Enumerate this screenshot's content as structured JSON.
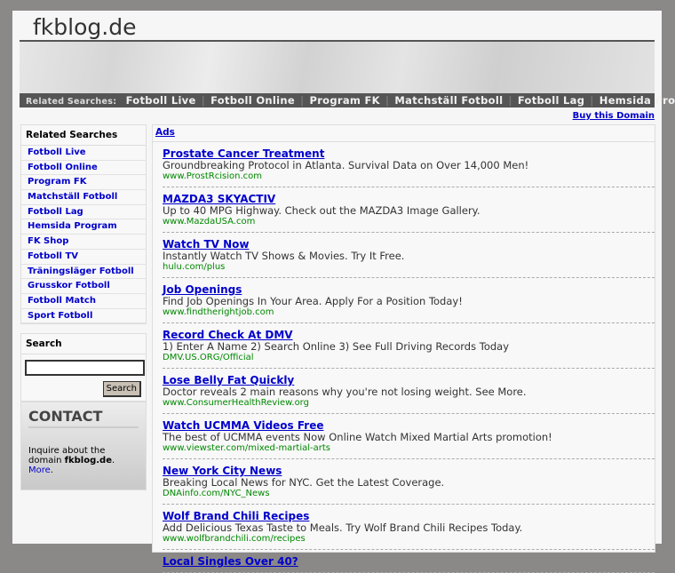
{
  "site_title": "fkblog.de",
  "nav": {
    "label": "Related Searches:",
    "items": [
      "Fotboll Live",
      "Fotboll Online",
      "Program FK",
      "Matchställ Fotboll",
      "Fotboll Lag",
      "Hemsida Program"
    ]
  },
  "buy_domain": "Buy this Domain",
  "related": {
    "title": "Related Searches",
    "items": [
      "Fotboll Live",
      "Fotboll Online",
      "Program FK",
      "Matchställ Fotboll",
      "Fotboll Lag",
      "Hemsida Program",
      "FK Shop",
      "Fotboll TV",
      "Träningsläger Fotboll",
      "Grusskor Fotboll",
      "Fotboll Match",
      "Sport Fotboll"
    ]
  },
  "search": {
    "title": "Search",
    "value": "",
    "button": "Search"
  },
  "contact": {
    "title": "CONTACT",
    "text": "Inquire about the domain",
    "domain": "fkblog.de",
    "more": "More"
  },
  "ads": {
    "title": "Ads",
    "items": [
      {
        "title": "Prostate Cancer Treatment",
        "desc": "Groundbreaking Protocol in Atlanta. Survival Data on Over 14,000 Men!",
        "url": "www.ProstRcision.com"
      },
      {
        "title": "MAZDA3 SKYACTIV",
        "desc": "Up to 40 MPG Highway. Check out the MAZDA3 Image Gallery.",
        "url": "www.MazdaUSA.com"
      },
      {
        "title": "Watch TV Now",
        "desc": "Instantly Watch TV Shows & Movies. Try It Free.",
        "url": "hulu.com/plus"
      },
      {
        "title": "Job Openings",
        "desc": "Find Job Openings In Your Area. Apply For a Position Today!",
        "url": "www.findtherightjob.com"
      },
      {
        "title": "Record Check At DMV",
        "desc": "1) Enter A Name 2) Search Online 3) See Full Driving Records Today",
        "url": "DMV.US.ORG/Official"
      },
      {
        "title": "Lose Belly Fat Quickly",
        "desc": "Doctor reveals 2 main reasons why you're not losing weight. See More.",
        "url": "www.ConsumerHealthReview.org"
      },
      {
        "title": "Watch UCMMA Videos Free",
        "desc": "The best of UCMMA events Now Online Watch Mixed Martial Arts promotion!",
        "url": "www.viewster.com/mixed-martial-arts"
      },
      {
        "title": "New York City News",
        "desc": "Breaking Local News for NYC. Get the Latest Coverage.",
        "url": "DNAinfo.com/NYC_News"
      },
      {
        "title": "Wolf Brand Chili Recipes",
        "desc": "Add Delicious Texas Taste to Meals. Try Wolf Brand Chili Recipes Today.",
        "url": "www.wolfbrandchili.com/recipes"
      },
      {
        "title": "Local Singles Over 40?",
        "desc": "",
        "url": ""
      }
    ]
  }
}
